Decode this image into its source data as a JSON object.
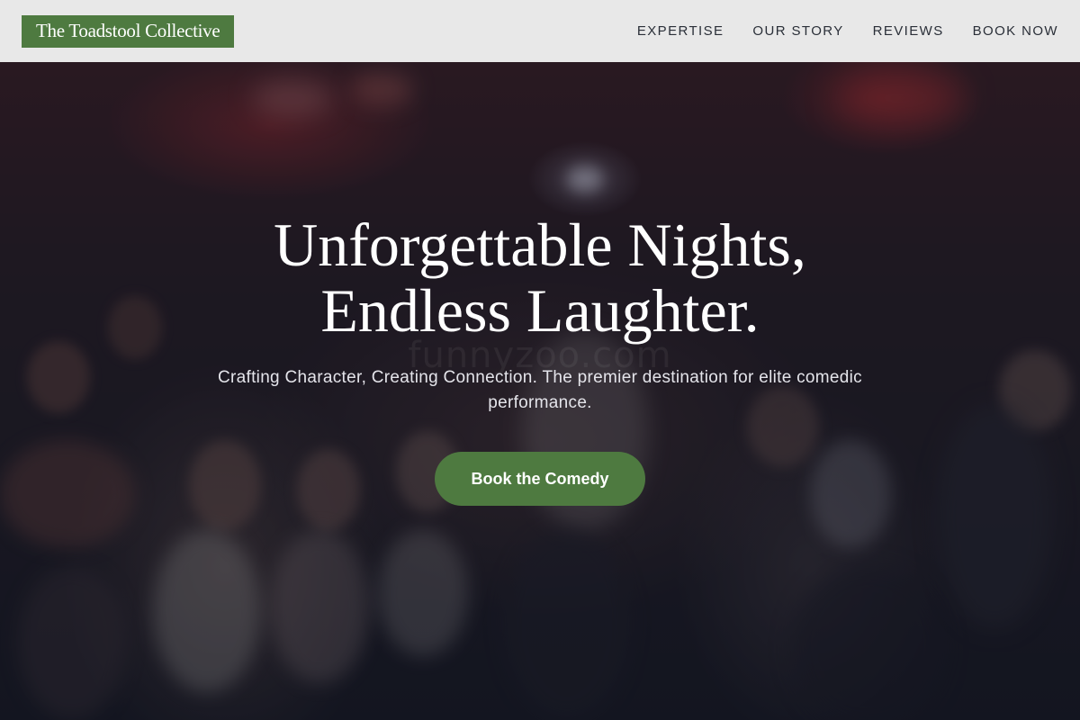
{
  "header": {
    "logo_text": "The Toadstool Collective",
    "nav": [
      {
        "label": "EXPERTISE"
      },
      {
        "label": "OUR STORY"
      },
      {
        "label": "REVIEWS"
      },
      {
        "label": "BOOK NOW"
      }
    ]
  },
  "hero": {
    "title_line1": "Unforgettable Nights,",
    "title_line2": "Endless Laughter.",
    "subtitle": "Crafting Character, Creating Connection. The premier destination for elite comedic performance.",
    "cta_label": "Book the Comedy",
    "watermark": "funnyzoo.com"
  },
  "colors": {
    "brand_green": "#4e7a40",
    "header_bg": "#e8e8e8",
    "nav_text": "#2a2f38"
  }
}
